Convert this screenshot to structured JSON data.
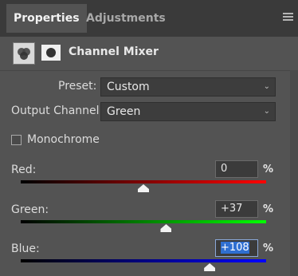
{
  "tabs": [
    {
      "label": "Properties"
    },
    {
      "label": "Adjustments"
    }
  ],
  "panel": {
    "title": "Channel Mixer",
    "adjustment_icon": "channel-mixer-icon",
    "mask_icon": "layer-mask-icon",
    "menu_icon": "panel-menu-icon"
  },
  "preset": {
    "label": "Preset:",
    "value": "Custom"
  },
  "output_channel": {
    "label": "Output Channel:",
    "value": "Green"
  },
  "monochrome": {
    "label": "Monochrome",
    "checked": false
  },
  "sliders": [
    {
      "label": "Red:",
      "value": "0",
      "unit": "%",
      "level": 0,
      "gradient": [
        "#000000",
        "#ff0000"
      ]
    },
    {
      "label": "Green:",
      "value": "+37",
      "unit": "%",
      "level": 37,
      "gradient": [
        "#000000",
        "#00ff00"
      ]
    },
    {
      "label": "Blue:",
      "value_selected": "+108",
      "unit": "%",
      "level": 108,
      "gradient": [
        "#000000",
        "#0000ff"
      ]
    }
  ],
  "slider_range": [
    -200,
    200
  ]
}
